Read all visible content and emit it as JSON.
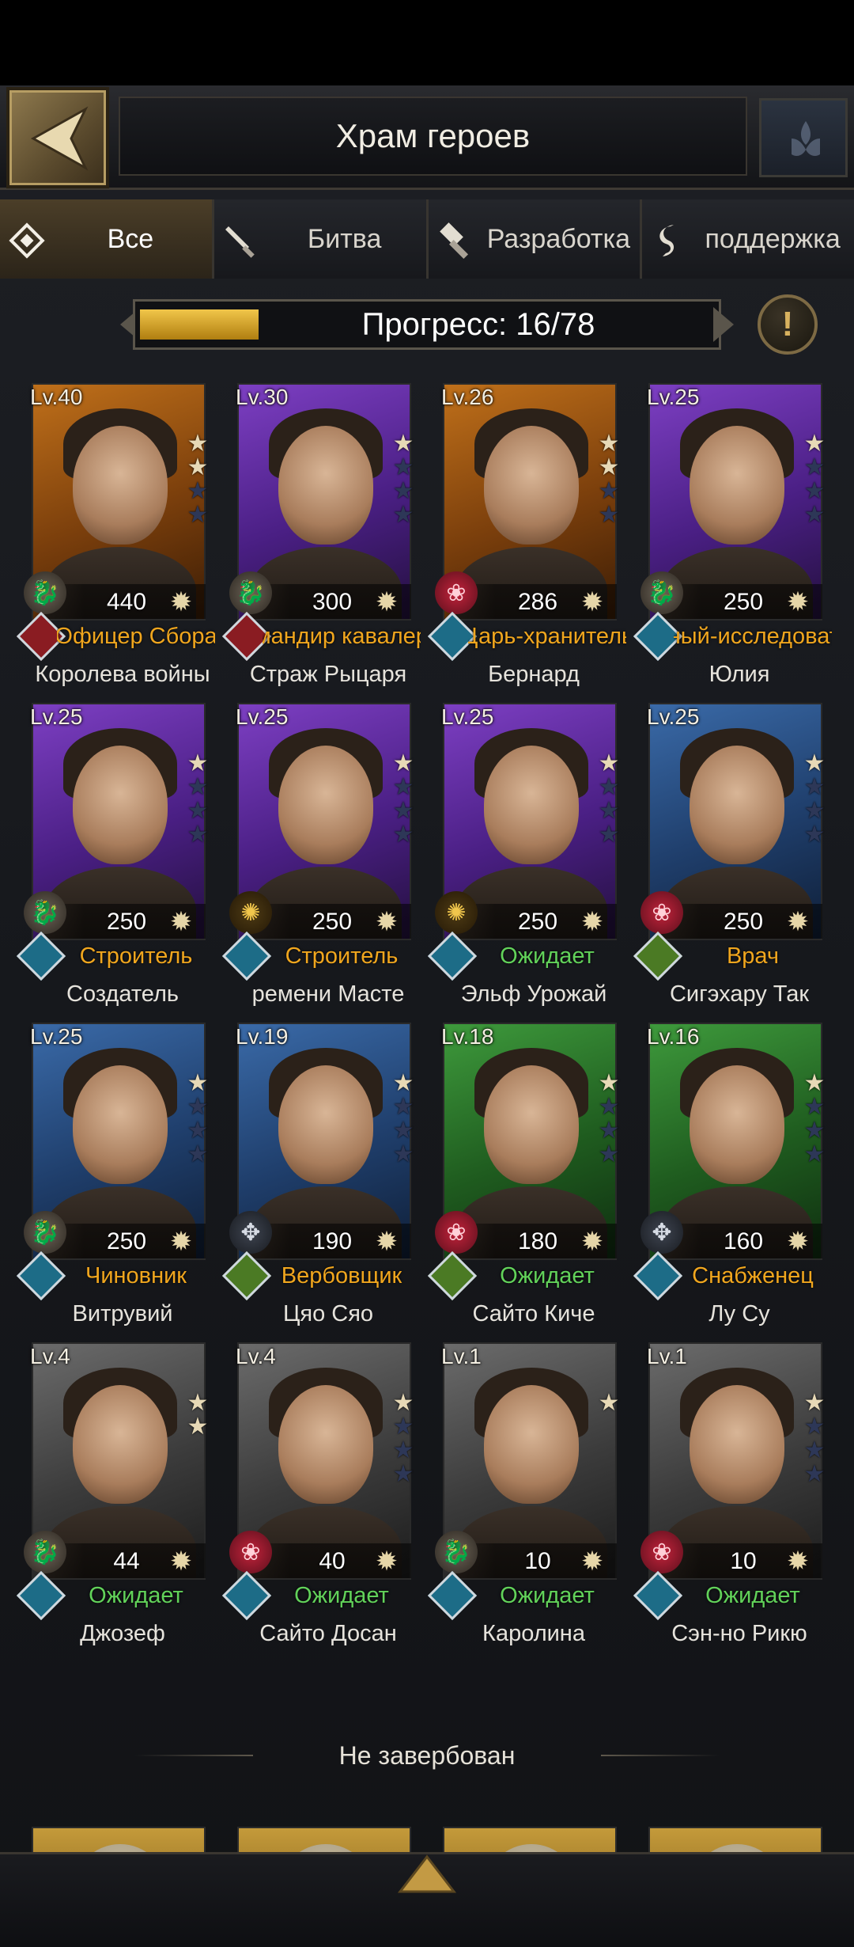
{
  "header": {
    "title": "Храм героев"
  },
  "tabs": [
    {
      "label": "Все",
      "icon": "diamond-icon",
      "active": true
    },
    {
      "label": "Битва",
      "icon": "sword-icon",
      "active": false
    },
    {
      "label": "Разработка",
      "icon": "hammer-icon",
      "active": false
    },
    {
      "label": "поддержка",
      "icon": "scroll-icon",
      "active": false
    }
  ],
  "progress": {
    "label": "Прогресс: 16/78",
    "fraction": 0.205
  },
  "info_symbol": "!",
  "heroes": [
    {
      "level": "Lv.40",
      "power": "440",
      "role": "Офицер Сбора",
      "name": "Королева войны"
    },
    {
      "level": "Lv.30",
      "power": "300",
      "role": "Командир кавалерии",
      "name": "Страж Рыцаря"
    },
    {
      "level": "Lv.26",
      "power": "286",
      "role": "Царь-хранитель",
      "name": "Бернард"
    },
    {
      "level": "Lv.25",
      "power": "250",
      "role": "Ученый-исследователь",
      "name": "Юлия"
    },
    {
      "level": "Lv.25",
      "power": "250",
      "role": "Строитель",
      "name": "Создатель"
    },
    {
      "level": "Lv.25",
      "power": "250",
      "role": "Строитель",
      "name": "ремени     Масте"
    },
    {
      "level": "Lv.25",
      "power": "250",
      "role": "Ожидает",
      "name": "Эльф Урожай"
    },
    {
      "level": "Lv.25",
      "power": "250",
      "role": "Врач",
      "name": "Сигэхару     Так"
    },
    {
      "level": "Lv.25",
      "power": "250",
      "role": "Чиновник",
      "name": "Витрувий"
    },
    {
      "level": "Lv.19",
      "power": "190",
      "role": "Вербовщик",
      "name": "Цяо Сяо"
    },
    {
      "level": "Lv.18",
      "power": "180",
      "role": "Ожидает",
      "name": "Сайто Киче"
    },
    {
      "level": "Lv.16",
      "power": "160",
      "role": "Снабженец",
      "name": "Лу Су"
    },
    {
      "level": "Lv.4",
      "power": "44",
      "role": "Ожидает",
      "name": "Джозеф"
    },
    {
      "level": "Lv.4",
      "power": "40",
      "role": "Ожидает",
      "name": "Сайто Досан"
    },
    {
      "level": "Lv.1",
      "power": "10",
      "role": "Ожидает",
      "name": "Каролина"
    },
    {
      "level": "Lv.1",
      "power": "10",
      "role": "Ожидает",
      "name": "Сэн-но Рикю"
    }
  ],
  "not_recruited_label": "Не завербован",
  "colors": {
    "role_busy": "#f0a61e",
    "role_waiting": "#62d25a",
    "accent_gold": "#d8b25f"
  }
}
